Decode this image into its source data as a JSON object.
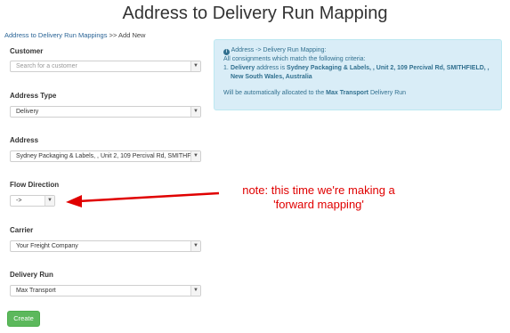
{
  "page": {
    "title": "Address to Delivery Run Mapping"
  },
  "breadcrumb": {
    "link": "Address to Delivery Run Mappings",
    "separator": ">>",
    "current": "Add New"
  },
  "form": {
    "customer": {
      "label": "Customer",
      "placeholder": "Search for a customer"
    },
    "address_type": {
      "label": "Address Type",
      "value": "Delivery"
    },
    "address": {
      "label": "Address",
      "value": "Sydney Packaging & Labels, , Unit 2, 109 Percival Rd, SMITHFIELD, , New South Wales, Australia"
    },
    "flow_direction": {
      "label": "Flow Direction",
      "value": "->"
    },
    "carrier": {
      "label": "Carrier",
      "value": "Your Freight Company"
    },
    "delivery_run": {
      "label": "Delivery Run",
      "value": "Max Transport"
    },
    "create_label": "Create"
  },
  "info": {
    "heading": "Address -> Delivery Run Mapping",
    "heading_suffix": ":",
    "intro": "All consignments which match the following criteria:",
    "item_num": "1.",
    "item_type": "Delivery",
    "item_mid": " address is ",
    "item_address": "Sydney Packaging & Labels, , Unit 2, 109 Percival Rd, SMITHFIELD, , New South Wales, Australia",
    "result_pre": "Will be automatically allocated to the ",
    "result_run": "Max Transport",
    "result_post": " Delivery Run"
  },
  "annotation": {
    "line1": "note: this time we're making a",
    "line2": "'forward mapping'",
    "color": "#e00000"
  },
  "colors": {
    "accent": "#2a6496",
    "info_bg": "#d9edf7",
    "info_text": "#31708f",
    "create": "#5cb85c"
  }
}
